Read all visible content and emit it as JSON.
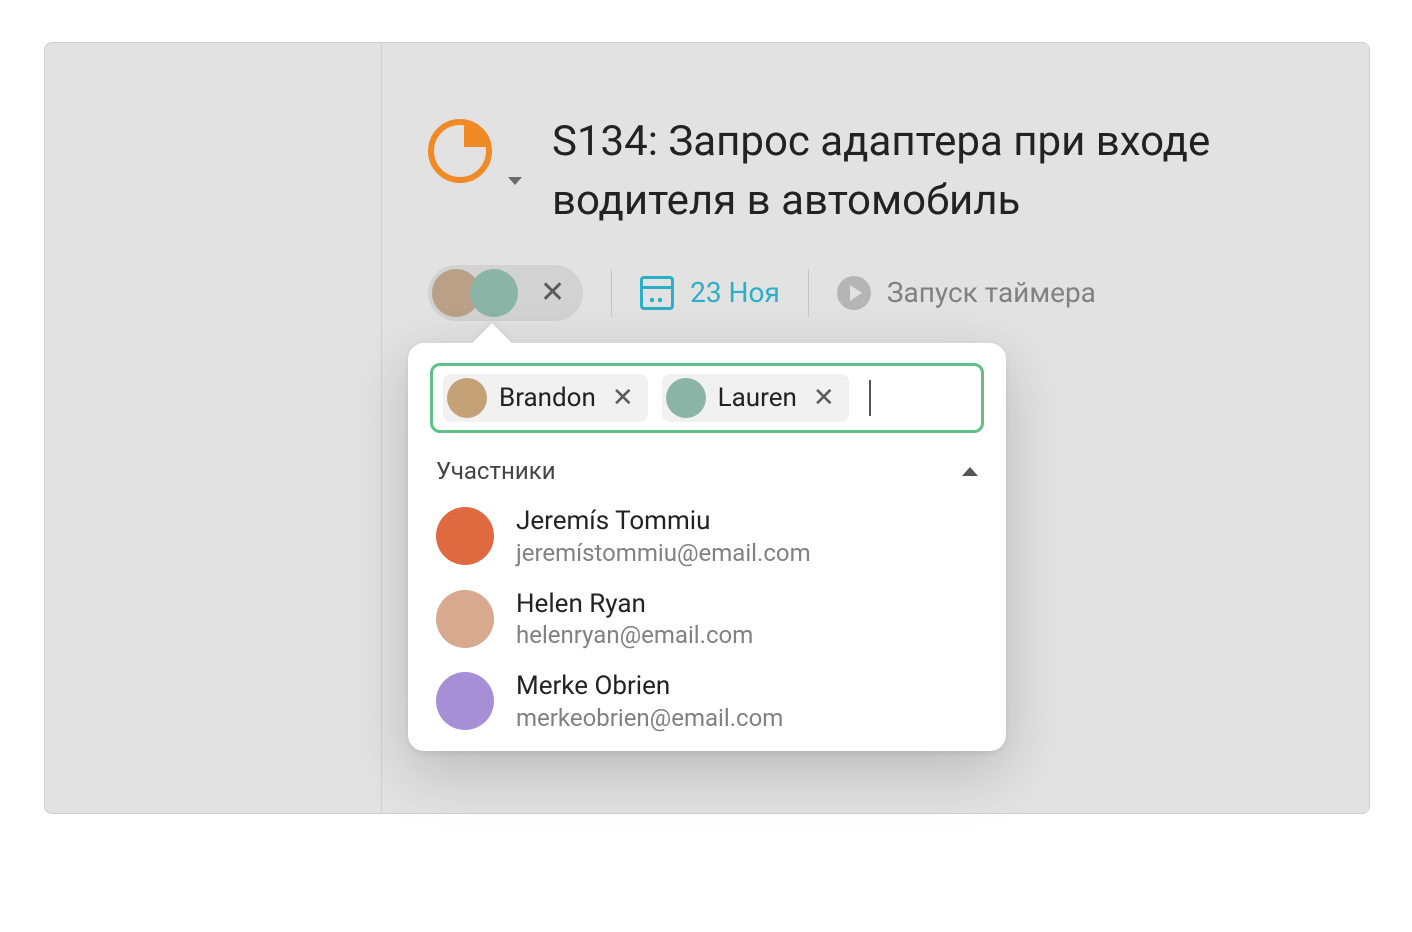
{
  "task": {
    "code": "S134",
    "title": "S134: Запрос адаптера при входе водителя в автомобиль"
  },
  "meta": {
    "date_label": "23 Ноя",
    "timer_label": "Запуск таймера"
  },
  "assignees": {
    "selected": [
      {
        "name": "Brandon"
      },
      {
        "name": "Lauren"
      }
    ]
  },
  "people_picker": {
    "section_label": "Участники",
    "chips": [
      {
        "name": "Brandon"
      },
      {
        "name": "Lauren"
      }
    ],
    "suggestions": [
      {
        "name": "Jeremís Tommiu",
        "email": "jeremístommiu@email.com"
      },
      {
        "name": "Helen Ryan",
        "email": "helenryan@email.com"
      },
      {
        "name": "Merke Obrien",
        "email": "merkeobrien@email.com"
      }
    ]
  }
}
